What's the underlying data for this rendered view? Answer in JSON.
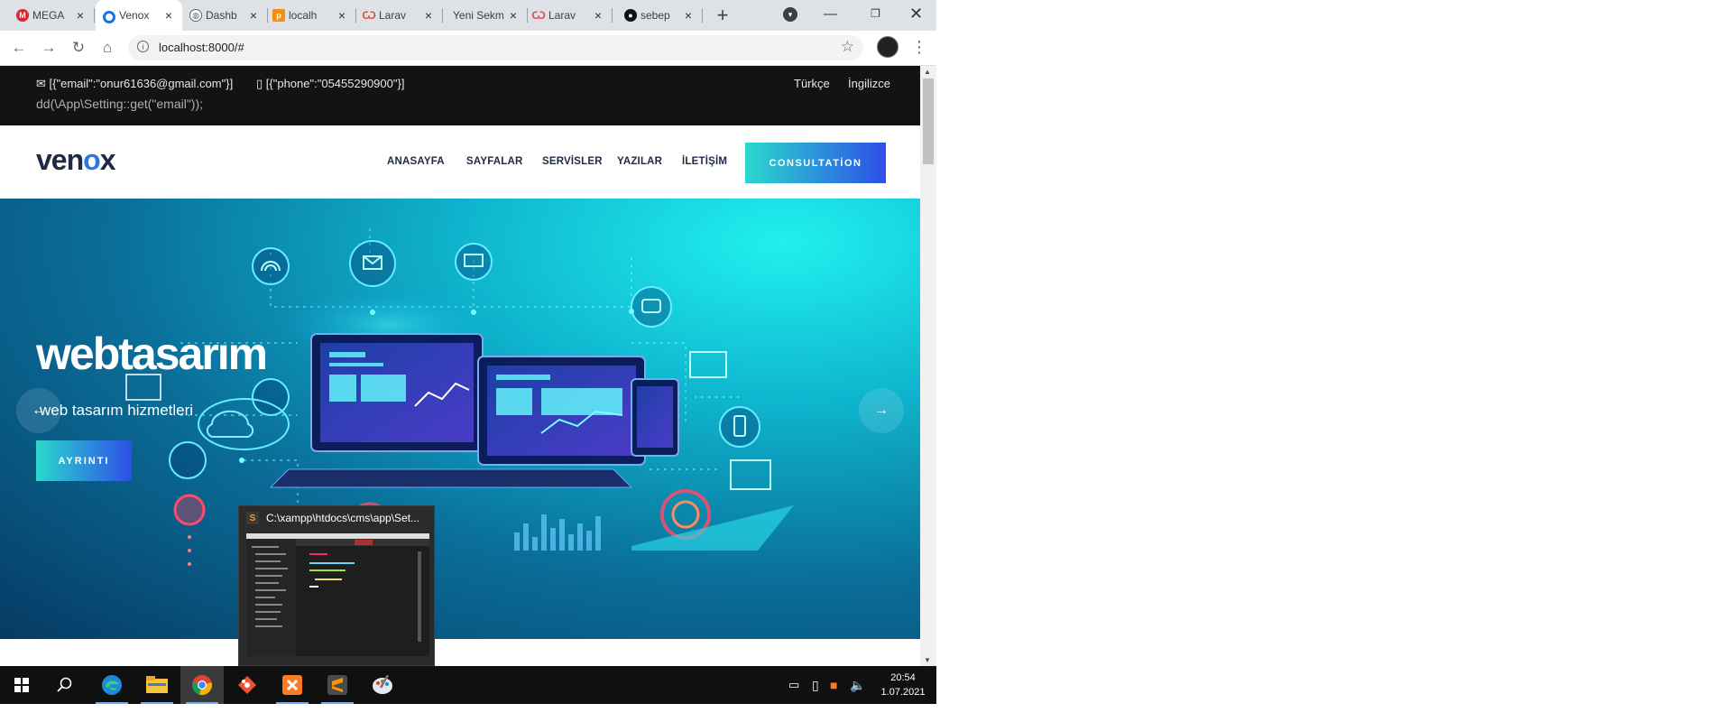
{
  "browser": {
    "tabs": [
      {
        "title": "MEGA",
        "favicon": "mega-icon",
        "color": "#d9272e"
      },
      {
        "title": "Venox",
        "favicon": "chrome-loading-icon",
        "color": "#1a73e8"
      },
      {
        "title": "Dashb",
        "favicon": "globe-icon",
        "color": "#5f6368"
      },
      {
        "title": "localh",
        "favicon": "phpmyadmin-icon",
        "color": "#f29111"
      },
      {
        "title": "Larav",
        "favicon": "laravel-icon",
        "color": "#e84a3f"
      },
      {
        "title": "Yeni Sekm",
        "favicon": "",
        "color": "#5f6368"
      },
      {
        "title": "Larav",
        "favicon": "laravel-icon",
        "color": "#e84a3f"
      },
      {
        "title": "sebep",
        "favicon": "github-icon",
        "color": "#111111"
      }
    ],
    "url": "localhost:8000/#"
  },
  "site": {
    "topbar": {
      "email": "[{\"email\":\"onur61636@gmail.com\"}]",
      "phone": "[{\"phone\":\"05455290900\"}]",
      "debug_line": "dd(\\App\\Setting::get(\"email\"));",
      "languages": [
        "Türkçe",
        "İngilizce"
      ]
    },
    "logo": {
      "prefix": "ven",
      "accent": "o",
      "suffix": "x"
    },
    "menu": [
      "ANASAYFA",
      "SAYFALAR",
      "SERVİSLER",
      "YAZILAR",
      "İLETİŞİM"
    ],
    "cta": "CONSULTATİON",
    "hero": {
      "title": "webtasarım",
      "subtitle": "web tasarım hizmetleri",
      "button": "AYRINTI",
      "prev": "←",
      "next": "→"
    }
  },
  "taskbar": {
    "preview_title": "C:\\xampp\\htdocs\\cms\\app\\Set...",
    "apps": [
      "windows-start-icon",
      "search-icon",
      "edge-icon",
      "file-explorer-icon",
      "chrome-icon",
      "git-icon",
      "xampp-icon",
      "sublime-text-icon",
      "paint-icon"
    ],
    "time": "20:54",
    "date": "1.07.2021"
  },
  "colors": {
    "accent_gradient_start": "#2ad9cc",
    "accent_gradient_end": "#2d4fe8",
    "topbar_bg": "#131313",
    "logo_navy": "#1f2a44",
    "logo_blue": "#2c77e4"
  }
}
